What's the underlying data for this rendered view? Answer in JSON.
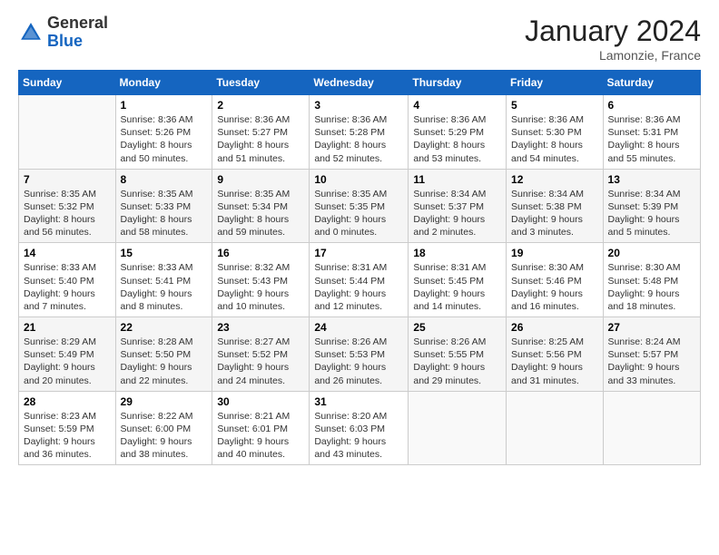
{
  "header": {
    "logo_general": "General",
    "logo_blue": "Blue",
    "title": "January 2024",
    "subtitle": "Lamonzie, France"
  },
  "columns": [
    "Sunday",
    "Monday",
    "Tuesday",
    "Wednesday",
    "Thursday",
    "Friday",
    "Saturday"
  ],
  "weeks": [
    [
      {
        "day": "",
        "info": ""
      },
      {
        "day": "1",
        "info": "Sunrise: 8:36 AM\nSunset: 5:26 PM\nDaylight: 8 hours\nand 50 minutes."
      },
      {
        "day": "2",
        "info": "Sunrise: 8:36 AM\nSunset: 5:27 PM\nDaylight: 8 hours\nand 51 minutes."
      },
      {
        "day": "3",
        "info": "Sunrise: 8:36 AM\nSunset: 5:28 PM\nDaylight: 8 hours\nand 52 minutes."
      },
      {
        "day": "4",
        "info": "Sunrise: 8:36 AM\nSunset: 5:29 PM\nDaylight: 8 hours\nand 53 minutes."
      },
      {
        "day": "5",
        "info": "Sunrise: 8:36 AM\nSunset: 5:30 PM\nDaylight: 8 hours\nand 54 minutes."
      },
      {
        "day": "6",
        "info": "Sunrise: 8:36 AM\nSunset: 5:31 PM\nDaylight: 8 hours\nand 55 minutes."
      }
    ],
    [
      {
        "day": "7",
        "info": "Sunrise: 8:35 AM\nSunset: 5:32 PM\nDaylight: 8 hours\nand 56 minutes."
      },
      {
        "day": "8",
        "info": "Sunrise: 8:35 AM\nSunset: 5:33 PM\nDaylight: 8 hours\nand 58 minutes."
      },
      {
        "day": "9",
        "info": "Sunrise: 8:35 AM\nSunset: 5:34 PM\nDaylight: 8 hours\nand 59 minutes."
      },
      {
        "day": "10",
        "info": "Sunrise: 8:35 AM\nSunset: 5:35 PM\nDaylight: 9 hours\nand 0 minutes."
      },
      {
        "day": "11",
        "info": "Sunrise: 8:34 AM\nSunset: 5:37 PM\nDaylight: 9 hours\nand 2 minutes."
      },
      {
        "day": "12",
        "info": "Sunrise: 8:34 AM\nSunset: 5:38 PM\nDaylight: 9 hours\nand 3 minutes."
      },
      {
        "day": "13",
        "info": "Sunrise: 8:34 AM\nSunset: 5:39 PM\nDaylight: 9 hours\nand 5 minutes."
      }
    ],
    [
      {
        "day": "14",
        "info": "Sunrise: 8:33 AM\nSunset: 5:40 PM\nDaylight: 9 hours\nand 7 minutes."
      },
      {
        "day": "15",
        "info": "Sunrise: 8:33 AM\nSunset: 5:41 PM\nDaylight: 9 hours\nand 8 minutes."
      },
      {
        "day": "16",
        "info": "Sunrise: 8:32 AM\nSunset: 5:43 PM\nDaylight: 9 hours\nand 10 minutes."
      },
      {
        "day": "17",
        "info": "Sunrise: 8:31 AM\nSunset: 5:44 PM\nDaylight: 9 hours\nand 12 minutes."
      },
      {
        "day": "18",
        "info": "Sunrise: 8:31 AM\nSunset: 5:45 PM\nDaylight: 9 hours\nand 14 minutes."
      },
      {
        "day": "19",
        "info": "Sunrise: 8:30 AM\nSunset: 5:46 PM\nDaylight: 9 hours\nand 16 minutes."
      },
      {
        "day": "20",
        "info": "Sunrise: 8:30 AM\nSunset: 5:48 PM\nDaylight: 9 hours\nand 18 minutes."
      }
    ],
    [
      {
        "day": "21",
        "info": "Sunrise: 8:29 AM\nSunset: 5:49 PM\nDaylight: 9 hours\nand 20 minutes."
      },
      {
        "day": "22",
        "info": "Sunrise: 8:28 AM\nSunset: 5:50 PM\nDaylight: 9 hours\nand 22 minutes."
      },
      {
        "day": "23",
        "info": "Sunrise: 8:27 AM\nSunset: 5:52 PM\nDaylight: 9 hours\nand 24 minutes."
      },
      {
        "day": "24",
        "info": "Sunrise: 8:26 AM\nSunset: 5:53 PM\nDaylight: 9 hours\nand 26 minutes."
      },
      {
        "day": "25",
        "info": "Sunrise: 8:26 AM\nSunset: 5:55 PM\nDaylight: 9 hours\nand 29 minutes."
      },
      {
        "day": "26",
        "info": "Sunrise: 8:25 AM\nSunset: 5:56 PM\nDaylight: 9 hours\nand 31 minutes."
      },
      {
        "day": "27",
        "info": "Sunrise: 8:24 AM\nSunset: 5:57 PM\nDaylight: 9 hours\nand 33 minutes."
      }
    ],
    [
      {
        "day": "28",
        "info": "Sunrise: 8:23 AM\nSunset: 5:59 PM\nDaylight: 9 hours\nand 36 minutes."
      },
      {
        "day": "29",
        "info": "Sunrise: 8:22 AM\nSunset: 6:00 PM\nDaylight: 9 hours\nand 38 minutes."
      },
      {
        "day": "30",
        "info": "Sunrise: 8:21 AM\nSunset: 6:01 PM\nDaylight: 9 hours\nand 40 minutes."
      },
      {
        "day": "31",
        "info": "Sunrise: 8:20 AM\nSunset: 6:03 PM\nDaylight: 9 hours\nand 43 minutes."
      },
      {
        "day": "",
        "info": ""
      },
      {
        "day": "",
        "info": ""
      },
      {
        "day": "",
        "info": ""
      }
    ]
  ]
}
